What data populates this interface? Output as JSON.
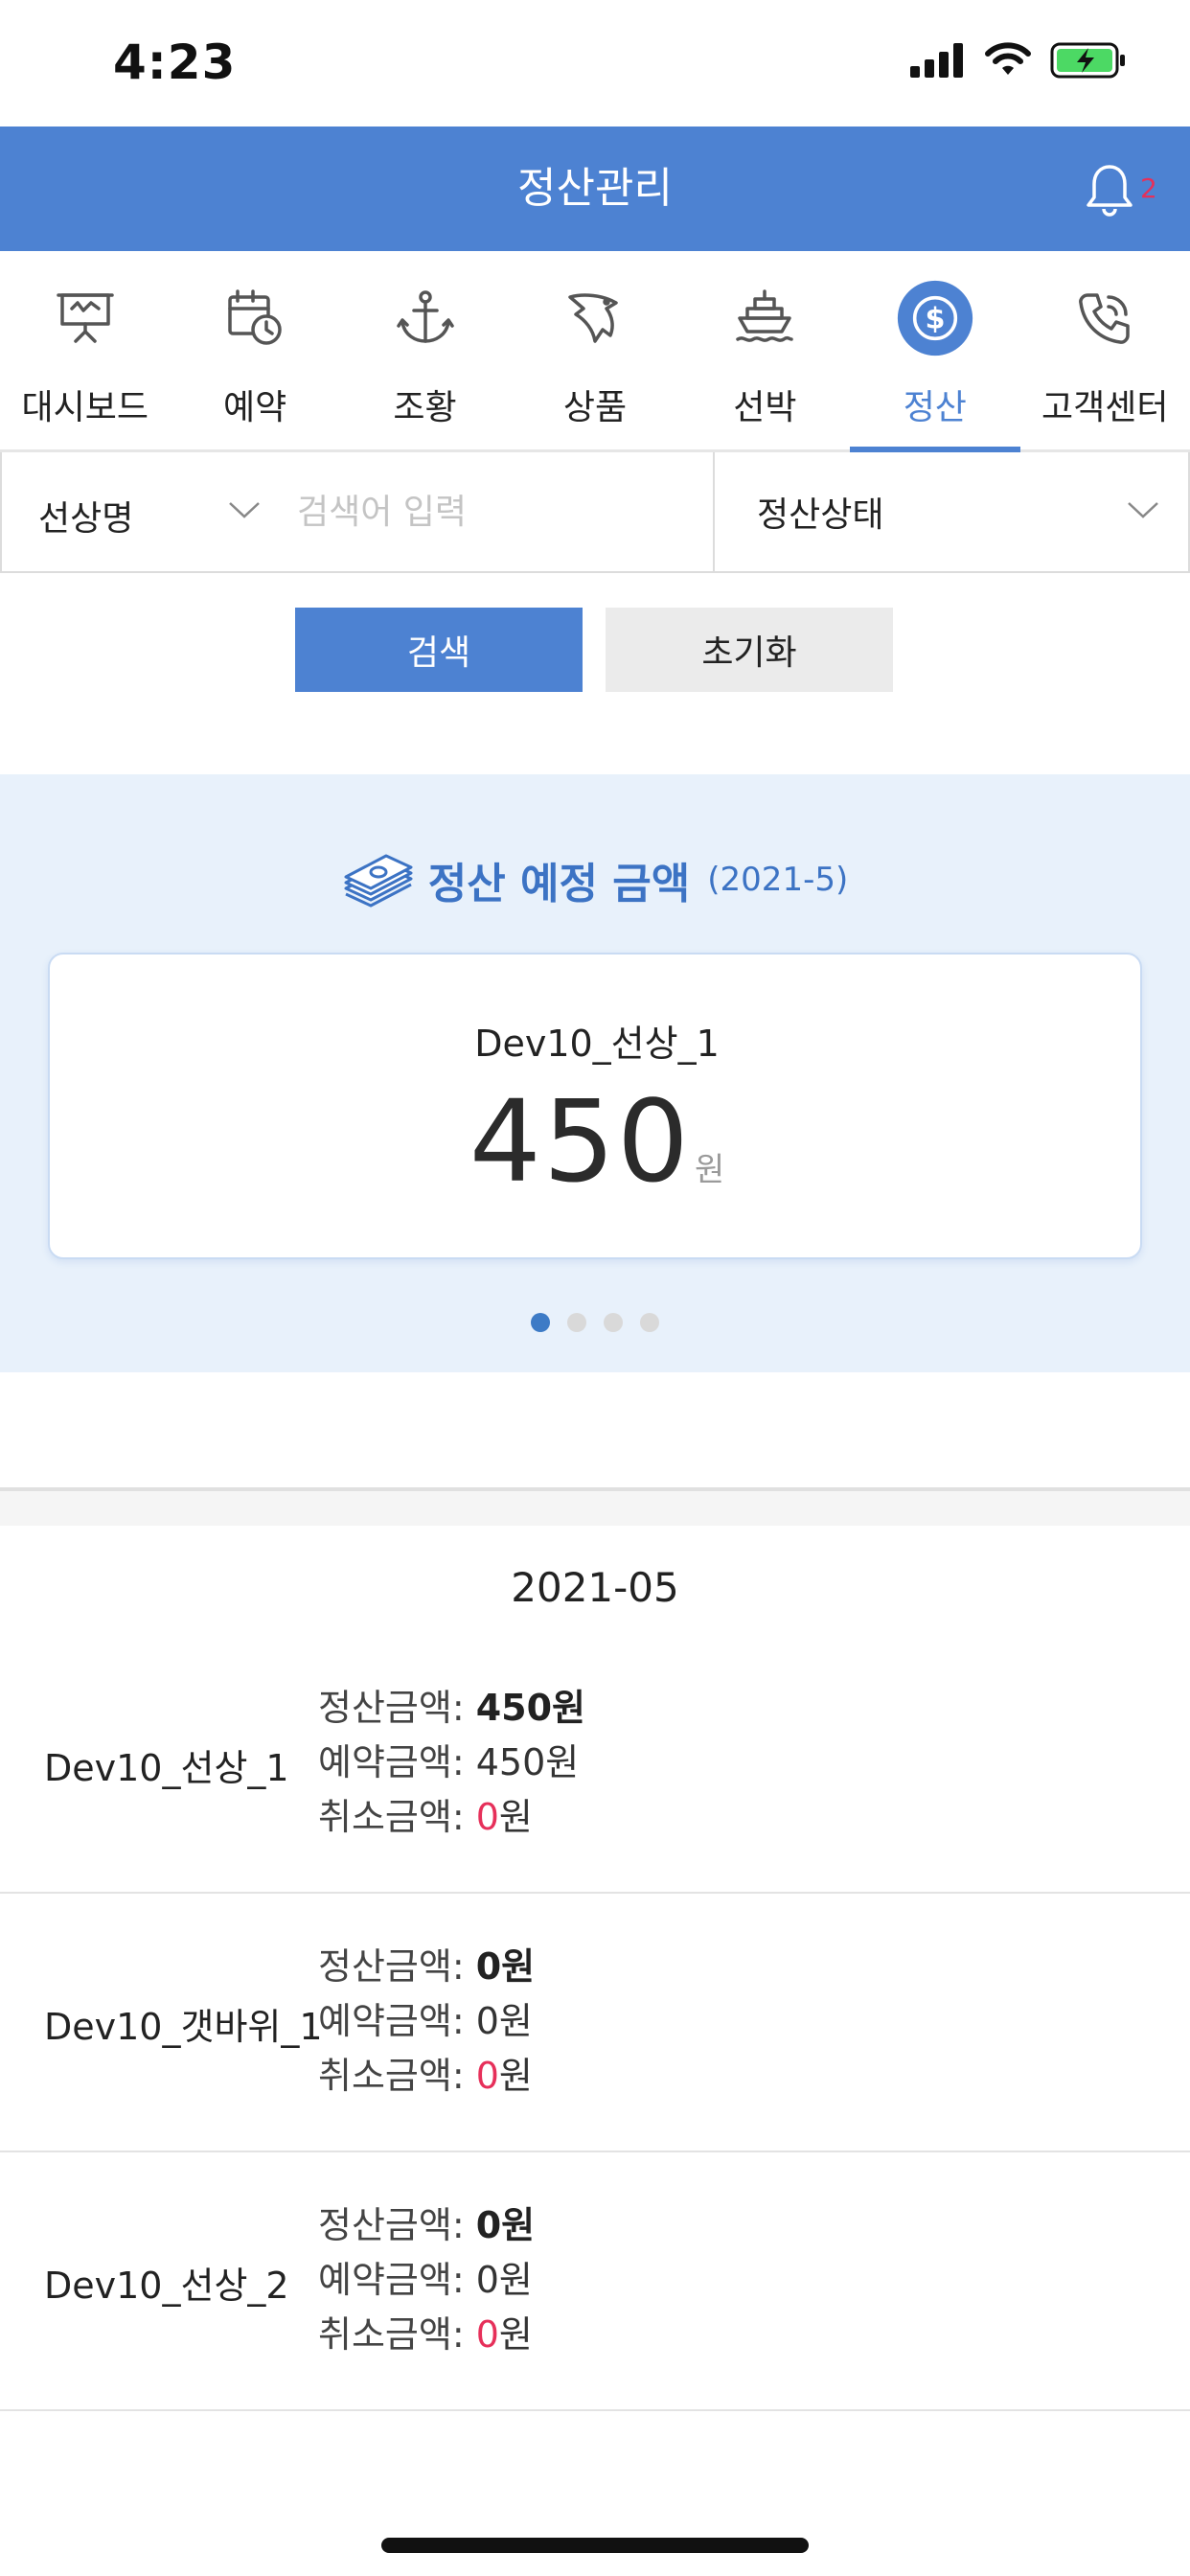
{
  "status_bar": {
    "time": "4:23"
  },
  "header": {
    "title": "정산관리",
    "notification_count": "2"
  },
  "tabs": [
    {
      "label": "대시보드",
      "icon": "presentation-board-icon",
      "active": false
    },
    {
      "label": "예약",
      "icon": "calendar-clock-icon",
      "active": false
    },
    {
      "label": "조황",
      "icon": "anchor-icon",
      "active": false
    },
    {
      "label": "상품",
      "icon": "fish-icon",
      "active": false
    },
    {
      "label": "선박",
      "icon": "ship-icon",
      "active": false
    },
    {
      "label": "정산",
      "icon": "dollar-circle-icon",
      "active": true
    },
    {
      "label": "고객센터",
      "icon": "phone-icon",
      "active": false
    }
  ],
  "filters": {
    "type_select": "선상명",
    "search_placeholder": "검색어 입력",
    "status_select": "정산상태"
  },
  "buttons": {
    "search": "검색",
    "reset": "초기화"
  },
  "summary": {
    "title": "정산 예정 금액",
    "period": "(2021-5)",
    "card_name": "Dev10_선상_1",
    "amount": "450",
    "unit": "원",
    "page_count": 4,
    "current_page": 1
  },
  "list": {
    "month": "2021-05",
    "labels": {
      "settle": "정산금액: ",
      "reserve": "예약금액: ",
      "cancel": "취소금액: "
    },
    "rows": [
      {
        "name": "Dev10_선상_1",
        "settle": "450원",
        "reserve": "450원",
        "cancel_num": "0",
        "cancel_unit": "원"
      },
      {
        "name": "Dev10_갯바위_1",
        "settle": "0원",
        "reserve": "0원",
        "cancel_num": "0",
        "cancel_unit": "원"
      },
      {
        "name": "Dev10_선상_2",
        "settle": "0원",
        "reserve": "0원",
        "cancel_num": "0",
        "cancel_unit": "원"
      }
    ]
  },
  "colors": {
    "primary": "#4d82d2",
    "summary_bg": "#e8f1fb",
    "cancel_red": "#e6305a"
  }
}
